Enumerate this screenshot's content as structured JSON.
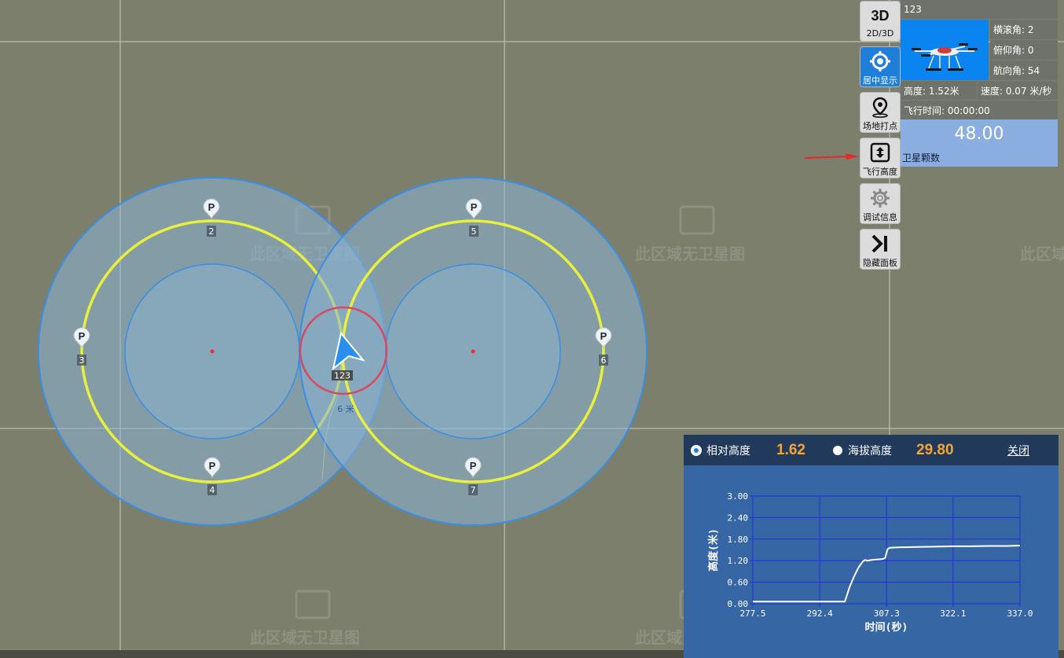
{
  "map": {
    "watermark": "此区域无卫星图",
    "waypoints": [
      {
        "label": "P",
        "num": "2"
      },
      {
        "label": "P",
        "num": "3"
      },
      {
        "label": "P",
        "num": "4"
      },
      {
        "label": "P",
        "num": "5"
      },
      {
        "label": "P",
        "num": "6"
      },
      {
        "label": "P",
        "num": "7"
      }
    ],
    "drone_label": "123",
    "distance_label": "6 米"
  },
  "toolbar": {
    "btn_3d_icon": "3D",
    "btn_3d": "2D/3D",
    "btn_center": "居中显示",
    "btn_mark": "场地打点",
    "btn_height": "飞行高度",
    "btn_debug": "调试信息",
    "btn_hide_icon": "▶|",
    "btn_hide": "隐藏面板"
  },
  "panel": {
    "title": "123",
    "roll": "横滚角: 2",
    "pitch": "俯仰角: 0",
    "yaw": "航向角: 54",
    "height": "高度: 1.52米",
    "speed": "速度: 0.07 米/秒",
    "flight_time": "飞行时间: 00:00:00",
    "sat_value": "48.00",
    "sat_label": "卫星颗数"
  },
  "chart_panel": {
    "relative_label": "相对高度",
    "relative_value": "1.62",
    "altitude_label": "海拔高度",
    "altitude_value": "29.80",
    "close": "关闭"
  },
  "colors": {
    "map_bg": "#7c7f6c",
    "toolbar_active": "#1e7ed8",
    "circle_yellow": "#e8f03c",
    "circle_blue": "#3a8ee6",
    "value_orange": "#f7a436",
    "chart_bg": "#3666a3",
    "chart_line": "#ffffff"
  },
  "chart_data": {
    "type": "line",
    "xlabel": "时间(秒)",
    "ylabel": "高度(米)",
    "xlim": [
      277.5,
      337.0
    ],
    "ylim": [
      0,
      3.0
    ],
    "x_ticks": [
      "277.5",
      "292.4",
      "307.3",
      "322.1",
      "337.0"
    ],
    "y_ticks": [
      "0.00",
      "0.60",
      "1.20",
      "1.80",
      "2.40",
      "3.00"
    ],
    "grid": true,
    "series": [
      {
        "x": [
          277.5,
          282.0,
          286.0,
          290.0,
          294.0,
          298.0,
          298.5,
          299.0,
          300.0,
          301.0,
          302.0,
          302.5,
          303.0,
          304.0,
          305.0,
          306.0,
          306.5,
          307.0,
          307.5,
          308.0,
          310.0,
          314.0,
          318.0,
          322.0,
          326.0,
          330.0,
          334.0,
          337.0
        ],
        "y": [
          0.06,
          0.06,
          0.06,
          0.06,
          0.06,
          0.06,
          0.25,
          0.45,
          0.75,
          1.0,
          1.18,
          1.22,
          1.2,
          1.22,
          1.23,
          1.24,
          1.25,
          1.28,
          1.52,
          1.56,
          1.57,
          1.58,
          1.59,
          1.6,
          1.6,
          1.61,
          1.61,
          1.62
        ]
      }
    ]
  }
}
